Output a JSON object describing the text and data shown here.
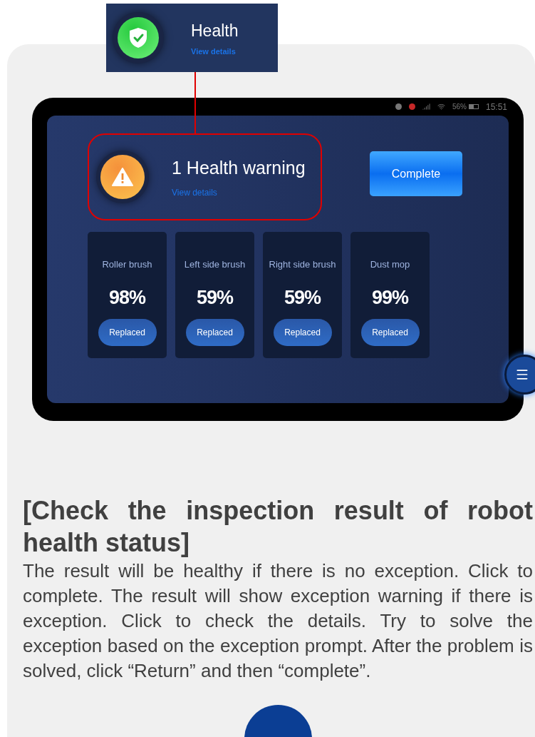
{
  "callout": {
    "title": "Health",
    "link": "View details"
  },
  "device": {
    "status_bar": {
      "battery": "56%",
      "time": "15:51"
    },
    "warning": {
      "title": "1 Health warning",
      "link": "View details"
    },
    "complete_button": "Complete",
    "parts": [
      {
        "name": "Roller brush",
        "percent": "98%",
        "action": "Replaced"
      },
      {
        "name": "Left side brush",
        "percent": "59%",
        "action": "Replaced"
      },
      {
        "name": "Right side brush",
        "percent": "59%",
        "action": "Replaced"
      },
      {
        "name": "Dust mop",
        "percent": "99%",
        "action": "Replaced"
      }
    ]
  },
  "instruction": {
    "heading": "[Check the inspection result of robot health status]",
    "body": "The result will be healthy if there is no exception. Click to complete. The result will show exception warning if there is exception. Click to check the details. Try to solve the exception based on the exception prompt. After the problem is solved, click “Return” and then “complete”."
  }
}
